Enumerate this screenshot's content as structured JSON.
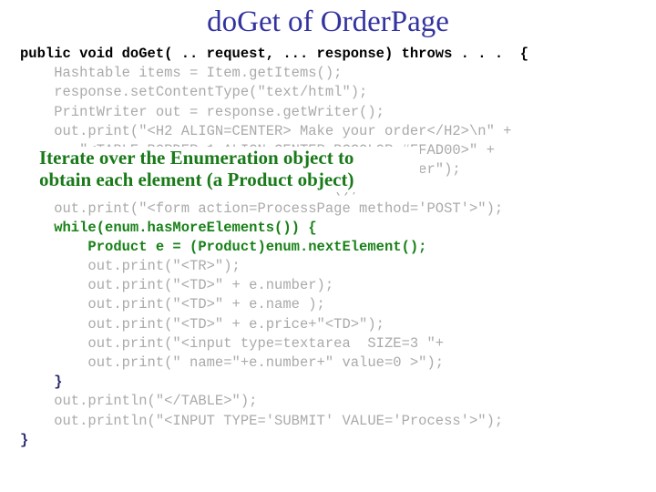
{
  "slide": {
    "title": "doGet of OrderPage",
    "title_color": "#3333a0",
    "background_color": "#ffffff"
  },
  "code": {
    "font": "monospace",
    "colors": {
      "signature": "#000000",
      "dimmed": "#aaaaaa",
      "highlight": "#178117",
      "brace": "#2a2a6e"
    },
    "lines": [
      {
        "text": "public void doGet( .. request, ... response) throws . . .  {",
        "style": "black"
      },
      {
        "text": "    Hashtable items = Item.getItems();",
        "style": "grey"
      },
      {
        "text": "    response.setContentType(\"text/html\");",
        "style": "grey"
      },
      {
        "text": "    PrintWriter out = response.getWriter();",
        "style": "grey"
      },
      {
        "text": "    out.print(\"<H2 ALIGN=CENTER> Make your order</H2>\\n\" +",
        "style": "grey"
      },
      {
        "text": "       \"<TABLE BORDER=1 ALIGN=CENTER BGCOLOR=#FFAD00>\" +",
        "style": "grey"
      },
      {
        "text": "       \"<TH> Item <TH> Name <TH>Price <TH> Number\");",
        "style": "grey"
      },
      {
        "text": "    Enumeration enum = items.elements();",
        "style": "grey"
      },
      {
        "text": "    out.print(\"<form action=ProcessPage method='POST'>\");",
        "style": "grey"
      },
      {
        "text": "    while(enum.hasMoreElements()) {",
        "style": "green"
      },
      {
        "text": "        Product e = (Product)enum.nextElement();",
        "style": "green"
      },
      {
        "text": "        out.print(\"<TR>\");",
        "style": "grey"
      },
      {
        "text": "        out.print(\"<TD>\" + e.number);",
        "style": "grey"
      },
      {
        "text": "        out.print(\"<TD>\" + e.name );",
        "style": "grey"
      },
      {
        "text": "        out.print(\"<TD>\" + e.price+\"<TD>\");",
        "style": "grey"
      },
      {
        "text": "        out.print(\"<input type=textarea  SIZE=3 \"+",
        "style": "grey"
      },
      {
        "text": "        out.print(\" name=\"+e.number+\" value=0 >\");",
        "style": "grey"
      },
      {
        "text": "    }",
        "style": "navy"
      },
      {
        "text": "    out.println(\"</TABLE>\");",
        "style": "grey"
      },
      {
        "text": "    out.println(\"<INPUT TYPE='SUBMIT' VALUE='Process'>\");",
        "style": "grey"
      },
      {
        "text": "}",
        "style": "navy"
      }
    ]
  },
  "annotation": {
    "line1": "Iterate over the Enumeration object to",
    "line2": "obtain each element (a  Product object)",
    "color": "#1a7a1a"
  }
}
